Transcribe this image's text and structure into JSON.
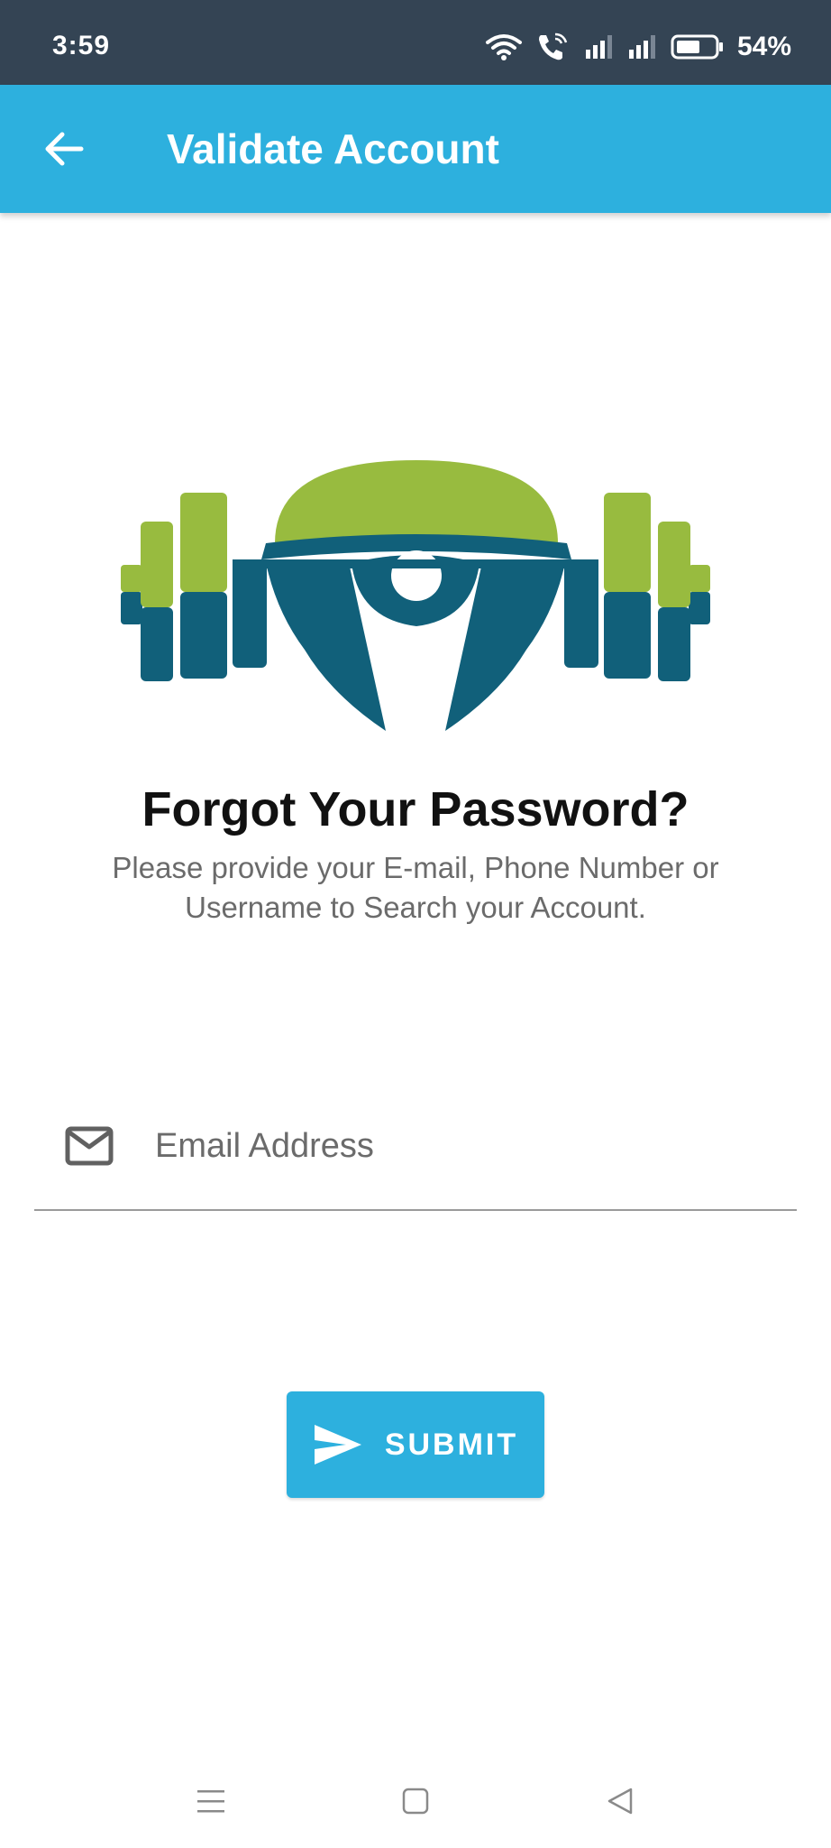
{
  "status_bar": {
    "time": "3:59",
    "battery": "54%",
    "icons": [
      "wifi-icon",
      "wifi-calling-icon",
      "signal-1-icon",
      "signal-2-icon",
      "battery-icon"
    ]
  },
  "app_bar": {
    "title": "Validate Account",
    "back_icon": "arrow-back-icon"
  },
  "logo": {
    "icon": "fitness-weightlifter-logo",
    "colors": {
      "green": "#98bb3f",
      "teal": "#11607a"
    }
  },
  "content": {
    "heading": "Forgot Your Password?",
    "description": "Please provide your E-mail, Phone Number or Username to Search your Account."
  },
  "email_field": {
    "icon": "mail-icon",
    "placeholder": "Email Address",
    "value": ""
  },
  "submit_button": {
    "icon": "send-icon",
    "label": "SUBMIT"
  },
  "nav_bar": {
    "items": [
      "menu-icon",
      "home-square-icon",
      "back-triangle-icon"
    ]
  },
  "colors": {
    "status_bar": "#344454",
    "accent": "#2db0de",
    "text_dark": "#111111",
    "text_muted": "#6b6b6b"
  }
}
